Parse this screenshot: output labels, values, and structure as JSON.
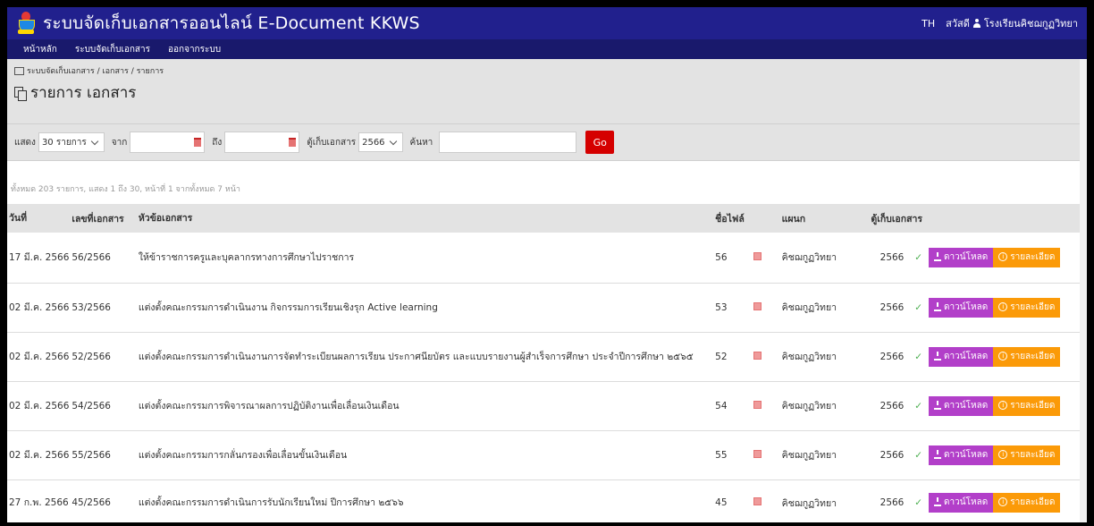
{
  "header": {
    "app_title": "ระบบจัดเก็บเอกสารออนไลน์ E-Document KKWS",
    "lang": "TH",
    "greeting": "สวัสดี",
    "user": "โรงเรียนคิชฌกูฏวิทยา"
  },
  "nav": [
    "หน้าหลัก",
    "ระบบจัดเก็บเอกสาร",
    "ออกจากระบบ"
  ],
  "breadcrumb": "ระบบจัดเก็บเอกสาร / เอกสาร / รายการ",
  "page_title": "รายการ เอกสาร",
  "filters": {
    "show_label": "แสดง",
    "show_value": "30 รายการ",
    "from_label": "จาก",
    "to_label": "ถึง",
    "cabinet_label": "ตู้เก็บเอกสาร",
    "cabinet_value": "2566",
    "search_label": "ค้นหา",
    "go_label": "Go"
  },
  "summary": "ทั้งหมด 203 รายการ, แสดง 1 ถึง 30, หน้าที่ 1 จากทั้งหมด 7 หน้า",
  "columns": {
    "date": "วันที่",
    "doc_no": "เลขที่เอกสาร",
    "title": "หัวข้อเอกสาร",
    "filename": "ชื่อไฟล์",
    "dept": "แผนก",
    "cabinet": "ตู้เก็บเอกสาร"
  },
  "actions": {
    "download": "ดาวน์โหลด",
    "details": "รายละเอียด"
  },
  "rows": [
    {
      "date": "17 มี.ค. 2566",
      "no": "56/2566",
      "title": "ให้ข้าราชการครูและบุคลากรทางการศึกษาไปราชการ",
      "file": "56",
      "dept": "คิชฌกูฏวิทยา",
      "cabinet": "2566"
    },
    {
      "date": "02 มี.ค. 2566",
      "no": "53/2566",
      "title": "แต่งตั้งคณะกรรมการดำเนินงาน กิจกรรมการเรียนเชิงรุก Active learning",
      "file": "53",
      "dept": "คิชฌกูฏวิทยา",
      "cabinet": "2566"
    },
    {
      "date": "02 มี.ค. 2566",
      "no": "52/2566",
      "title": "แต่งตั้งคณะกรรมการดำเนินงานการจัดทำระเบียนผลการเรียน ประกาศนียบัตร และแบบรายงานผู้สำเร็จการศึกษา ประจำปีการศึกษา ๒๕๖๕",
      "file": "52",
      "dept": "คิชฌกูฏวิทยา",
      "cabinet": "2566"
    },
    {
      "date": "02 มี.ค. 2566",
      "no": "54/2566",
      "title": "แต่งตั้งคณะกรรมการพิจารณาผลการปฏิบัติงานเพื่อเลื่อนเงินเดือน",
      "file": "54",
      "dept": "คิชฌกูฏวิทยา",
      "cabinet": "2566"
    },
    {
      "date": "02 มี.ค. 2566",
      "no": "55/2566",
      "title": "แต่งตั้งคณะกรรมการกลั่นกรองเพื่อเลื่อนขั้นเงินเดือน",
      "file": "55",
      "dept": "คิชฌกูฏวิทยา",
      "cabinet": "2566"
    },
    {
      "date": "27 ก.พ. 2566",
      "no": "45/2566",
      "title": "แต่งตั้งคณะกรรมการดำเนินการรับนักเรียนใหม่ ปีการศึกษา ๒๕๖๖",
      "file": "45",
      "dept": "คิชฌกูฏวิทยา",
      "cabinet": "2566"
    }
  ]
}
